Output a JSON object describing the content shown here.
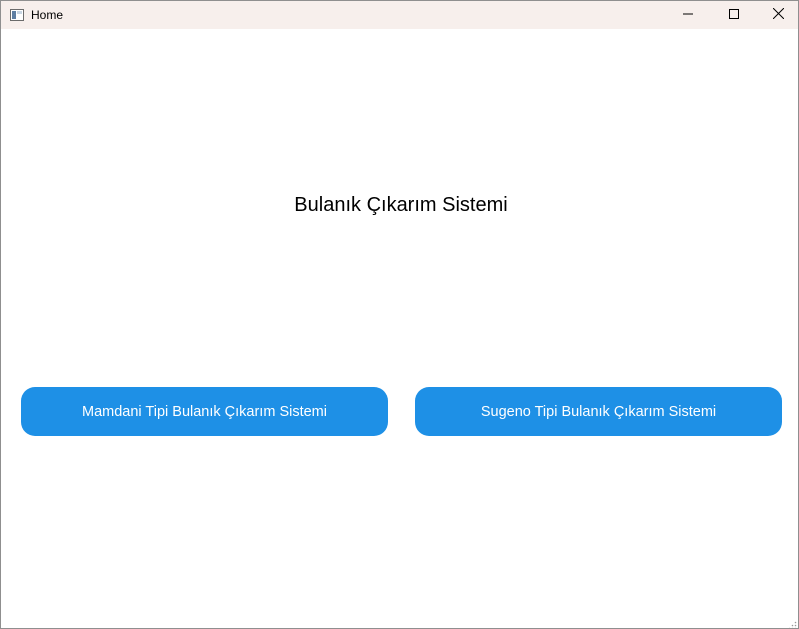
{
  "window": {
    "title": "Home",
    "controls": {
      "minimize_icon": "minimize-icon",
      "maximize_icon": "maximize-icon",
      "close_icon": "close-icon"
    }
  },
  "main": {
    "heading": "Bulanık Çıkarım Sistemi",
    "buttons": {
      "mamdani": "Mamdani Tipi Bulanık Çıkarım Sistemi",
      "sugeno": "Sugeno Tipi Bulanık Çıkarım Sistemi"
    }
  },
  "colors": {
    "titlebar": "#f7efec",
    "button_bg": "#1e90e6",
    "button_text": "#ffffff",
    "background": "#ffffff"
  }
}
